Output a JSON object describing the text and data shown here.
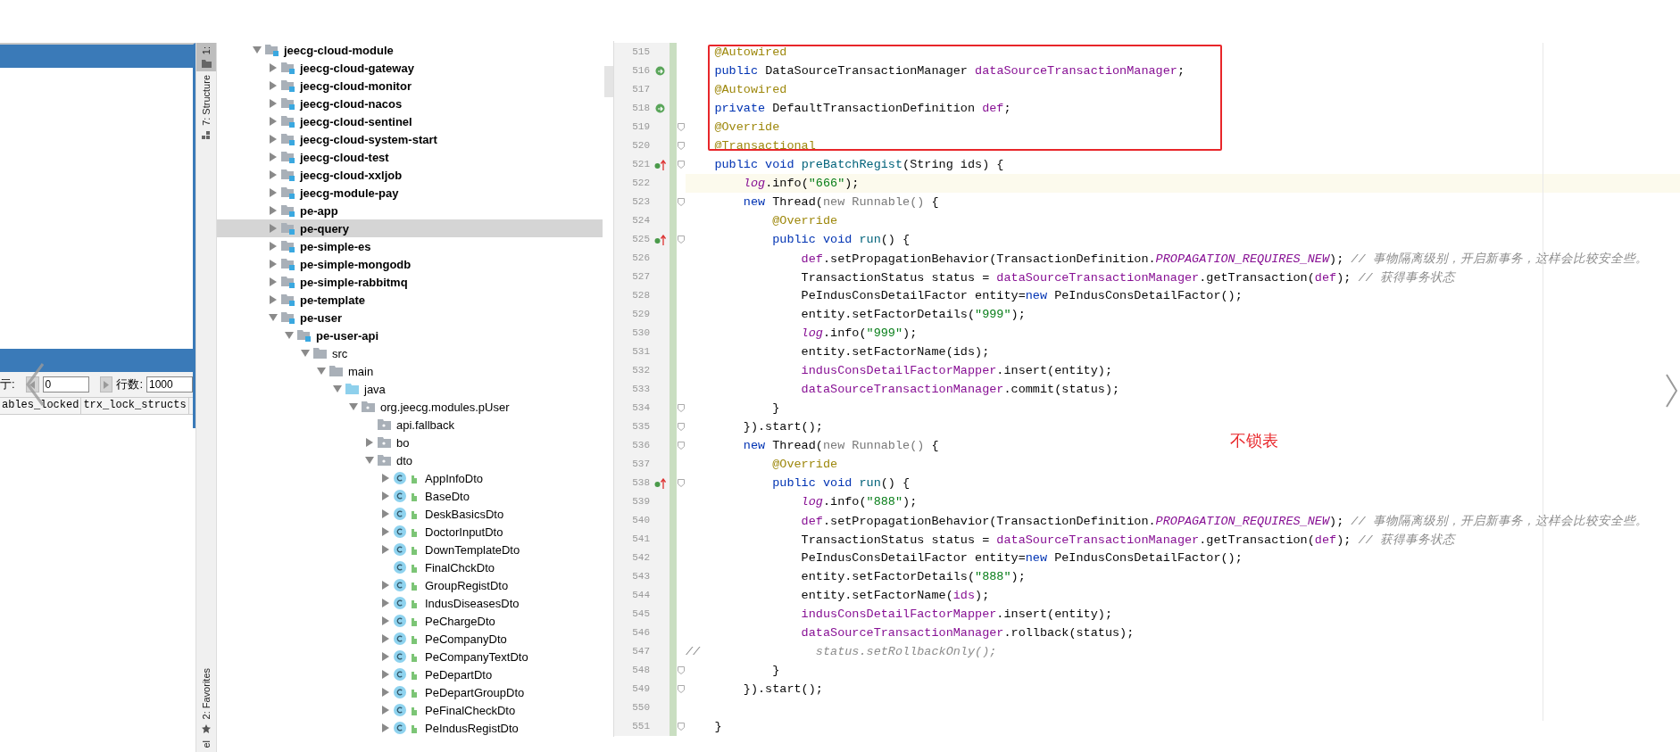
{
  "db_panel": {
    "pager": {
      "row_label": "亍:",
      "row_value": "0",
      "count_label": "行数:",
      "count_value": "1000"
    },
    "columns": [
      "ables_locked",
      "trx_lock_structs"
    ]
  },
  "side_tabs": [
    {
      "label": "1:",
      "kind": "folder",
      "selected": true
    },
    {
      "label": "7: Structure",
      "kind": "structure",
      "selected": false
    },
    {
      "label": "2: Favorites",
      "kind": "star",
      "selected": false
    },
    {
      "label": "el",
      "kind": "none",
      "selected": false
    }
  ],
  "project_tree": [
    {
      "label": "jeecg-cloud-module",
      "kind": "module",
      "expanded": true,
      "leaf": false,
      "selected": false,
      "children": [
        {
          "label": "jeecg-cloud-gateway",
          "kind": "module",
          "expanded": false,
          "leaf": false,
          "selected": false
        },
        {
          "label": "jeecg-cloud-monitor",
          "kind": "module",
          "expanded": false,
          "leaf": false,
          "selected": false
        },
        {
          "label": "jeecg-cloud-nacos",
          "kind": "module",
          "expanded": false,
          "leaf": false,
          "selected": false
        },
        {
          "label": "jeecg-cloud-sentinel",
          "kind": "module",
          "expanded": false,
          "leaf": false,
          "selected": false
        },
        {
          "label": "jeecg-cloud-system-start",
          "kind": "module",
          "expanded": false,
          "leaf": false,
          "selected": false
        },
        {
          "label": "jeecg-cloud-test",
          "kind": "module",
          "expanded": false,
          "leaf": false,
          "selected": false
        },
        {
          "label": "jeecg-cloud-xxljob",
          "kind": "module",
          "expanded": false,
          "leaf": false,
          "selected": false
        },
        {
          "label": "jeecg-module-pay",
          "kind": "module",
          "expanded": false,
          "leaf": false,
          "selected": false
        },
        {
          "label": "pe-app",
          "kind": "module",
          "expanded": false,
          "leaf": false,
          "selected": false
        },
        {
          "label": "pe-query",
          "kind": "module",
          "expanded": false,
          "leaf": false,
          "selected": true
        },
        {
          "label": "pe-simple-es",
          "kind": "module",
          "expanded": false,
          "leaf": false,
          "selected": false
        },
        {
          "label": "pe-simple-mongodb",
          "kind": "module",
          "expanded": false,
          "leaf": false,
          "selected": false
        },
        {
          "label": "pe-simple-rabbitmq",
          "kind": "module",
          "expanded": false,
          "leaf": false,
          "selected": false
        },
        {
          "label": "pe-template",
          "kind": "module",
          "expanded": false,
          "leaf": false,
          "selected": false
        },
        {
          "label": "pe-user",
          "kind": "module",
          "expanded": true,
          "leaf": false,
          "selected": false,
          "children": [
            {
              "label": "pe-user-api",
              "kind": "module",
              "expanded": true,
              "leaf": false,
              "selected": false,
              "children": [
                {
                  "label": "src",
                  "kind": "folder",
                  "expanded": true,
                  "leaf": false,
                  "selected": false,
                  "children": [
                    {
                      "label": "main",
                      "kind": "folder",
                      "expanded": true,
                      "leaf": false,
                      "selected": false,
                      "children": [
                        {
                          "label": "java",
                          "kind": "source",
                          "expanded": true,
                          "leaf": false,
                          "selected": false,
                          "children": [
                            {
                              "label": "org.jeecg.modules.pUser",
                              "kind": "package",
                              "expanded": true,
                              "leaf": false,
                              "selected": false,
                              "children": [
                                {
                                  "label": "api.fallback",
                                  "kind": "package",
                                  "leaf": true,
                                  "selected": false
                                },
                                {
                                  "label": "bo",
                                  "kind": "package",
                                  "expanded": false,
                                  "leaf": false,
                                  "selected": false
                                },
                                {
                                  "label": "dto",
                                  "kind": "package",
                                  "expanded": true,
                                  "leaf": false,
                                  "selected": false,
                                  "children": [
                                    {
                                      "label": "AppInfoDto",
                                      "kind": "class",
                                      "expanded": false,
                                      "leaf": false,
                                      "selected": false
                                    },
                                    {
                                      "label": "BaseDto",
                                      "kind": "class",
                                      "expanded": false,
                                      "leaf": false,
                                      "selected": false
                                    },
                                    {
                                      "label": "DeskBasicsDto",
                                      "kind": "class",
                                      "expanded": false,
                                      "leaf": false,
                                      "selected": false
                                    },
                                    {
                                      "label": "DoctorInputDto",
                                      "kind": "class",
                                      "expanded": false,
                                      "leaf": false,
                                      "selected": false
                                    },
                                    {
                                      "label": "DownTemplateDto",
                                      "kind": "class",
                                      "expanded": false,
                                      "leaf": false,
                                      "selected": false
                                    },
                                    {
                                      "label": "FinalChckDto",
                                      "kind": "class",
                                      "leaf": true,
                                      "selected": false
                                    },
                                    {
                                      "label": "GroupRegistDto",
                                      "kind": "class",
                                      "expanded": false,
                                      "leaf": false,
                                      "selected": false
                                    },
                                    {
                                      "label": "IndusDiseasesDto",
                                      "kind": "class",
                                      "expanded": false,
                                      "leaf": false,
                                      "selected": false
                                    },
                                    {
                                      "label": "PeChargeDto",
                                      "kind": "class",
                                      "expanded": false,
                                      "leaf": false,
                                      "selected": false
                                    },
                                    {
                                      "label": "PeCompanyDto",
                                      "kind": "class",
                                      "expanded": false,
                                      "leaf": false,
                                      "selected": false
                                    },
                                    {
                                      "label": "PeCompanyTextDto",
                                      "kind": "class",
                                      "expanded": false,
                                      "leaf": false,
                                      "selected": false
                                    },
                                    {
                                      "label": "PeDepartDto",
                                      "kind": "class",
                                      "expanded": false,
                                      "leaf": false,
                                      "selected": false
                                    },
                                    {
                                      "label": "PeDepartGroupDto",
                                      "kind": "class",
                                      "expanded": false,
                                      "leaf": false,
                                      "selected": false
                                    },
                                    {
                                      "label": "PeFinalCheckDto",
                                      "kind": "class",
                                      "expanded": false,
                                      "leaf": false,
                                      "selected": false
                                    },
                                    {
                                      "label": "PeIndusRegistDto",
                                      "kind": "class",
                                      "expanded": false,
                                      "leaf": false,
                                      "selected": false
                                    }
                                  ]
                                }
                              ]
                            }
                          ]
                        }
                      ]
                    }
                  ]
                }
              ]
            }
          ]
        }
      ]
    }
  ],
  "editor": {
    "note": "不锁表",
    "lines": [
      {
        "number": "515",
        "kind": "plain",
        "fold": false,
        "current": false,
        "segments": [
          {
            "kind": "ann",
            "text": "    @Autowired"
          }
        ]
      },
      {
        "number": "516",
        "kind": "bean",
        "fold": false,
        "current": false,
        "segments": [
          {
            "kind": "kw",
            "text": "    public "
          },
          {
            "kind": "plain",
            "text": "DataSourceTransactionManager "
          },
          {
            "kind": "field",
            "text": "dataSourceTransactionManager"
          },
          {
            "kind": "plain",
            "text": ";"
          }
        ]
      },
      {
        "number": "517",
        "kind": "plain",
        "fold": false,
        "current": false,
        "segments": [
          {
            "kind": "ann",
            "text": "    @Autowired"
          }
        ]
      },
      {
        "number": "518",
        "kind": "bean",
        "fold": false,
        "current": false,
        "segments": [
          {
            "kind": "kw",
            "text": "    private "
          },
          {
            "kind": "plain",
            "text": "DefaultTransactionDefinition "
          },
          {
            "kind": "field",
            "text": "def"
          },
          {
            "kind": "plain",
            "text": ";"
          }
        ]
      },
      {
        "number": "519",
        "kind": "plain",
        "fold": true,
        "current": false,
        "segments": [
          {
            "kind": "ann",
            "text": "    @Override"
          }
        ]
      },
      {
        "number": "520",
        "kind": "plain",
        "fold": true,
        "current": false,
        "segments": [
          {
            "kind": "ann",
            "text": "    @Transactional"
          }
        ]
      },
      {
        "number": "521",
        "kind": "override",
        "fold": true,
        "current": false,
        "segments": [
          {
            "kind": "kw",
            "text": "    public void "
          },
          {
            "kind": "decl",
            "text": "preBatchRegist"
          },
          {
            "kind": "plain",
            "text": "(String ids) {"
          }
        ]
      },
      {
        "number": "522",
        "kind": "plain",
        "fold": false,
        "current": true,
        "segments": [
          {
            "kind": "static",
            "text": "        log"
          },
          {
            "kind": "plain",
            "text": ".info("
          },
          {
            "kind": "str",
            "text": "\"666\""
          },
          {
            "kind": "plain",
            "text": ");"
          }
        ]
      },
      {
        "number": "523",
        "kind": "plain",
        "fold": true,
        "current": false,
        "segments": [
          {
            "kind": "kw",
            "text": "        new "
          },
          {
            "kind": "plain",
            "text": "Thread("
          },
          {
            "kind": "dim",
            "text": "new Runnable()"
          },
          {
            "kind": "plain",
            "text": " {"
          }
        ]
      },
      {
        "number": "524",
        "kind": "plain",
        "fold": false,
        "current": false,
        "segments": [
          {
            "kind": "ann",
            "text": "            @Override"
          }
        ]
      },
      {
        "number": "525",
        "kind": "override",
        "fold": true,
        "current": false,
        "segments": [
          {
            "kind": "kw",
            "text": "            public void "
          },
          {
            "kind": "decl",
            "text": "run"
          },
          {
            "kind": "plain",
            "text": "() {"
          }
        ]
      },
      {
        "number": "526",
        "kind": "plain",
        "fold": false,
        "current": false,
        "segments": [
          {
            "kind": "field",
            "text": "                def"
          },
          {
            "kind": "plain",
            "text": ".setPropagationBehavior(TransactionDefinition."
          },
          {
            "kind": "static",
            "text": "PROPAGATION_REQUIRES_NEW"
          },
          {
            "kind": "plain",
            "text": "); "
          },
          {
            "kind": "comment",
            "text": "// 事物隔离级别，开启新事务，这样会比较安全些。"
          }
        ]
      },
      {
        "number": "527",
        "kind": "plain",
        "fold": false,
        "current": false,
        "segments": [
          {
            "kind": "plain",
            "text": "                TransactionStatus status = "
          },
          {
            "kind": "field",
            "text": "dataSourceTransactionManager"
          },
          {
            "kind": "plain",
            "text": ".getTransaction("
          },
          {
            "kind": "field",
            "text": "def"
          },
          {
            "kind": "plain",
            "text": "); "
          },
          {
            "kind": "comment",
            "text": "// 获得事务状态"
          }
        ]
      },
      {
        "number": "528",
        "kind": "plain",
        "fold": false,
        "current": false,
        "segments": [
          {
            "kind": "plain",
            "text": "                PeIndusConsDetailFactor entity="
          },
          {
            "kind": "kw",
            "text": "new "
          },
          {
            "kind": "plain",
            "text": "PeIndusConsDetailFactor();"
          }
        ]
      },
      {
        "number": "529",
        "kind": "plain",
        "fold": false,
        "current": false,
        "segments": [
          {
            "kind": "plain",
            "text": "                entity.setFactorDetails("
          },
          {
            "kind": "str",
            "text": "\"999\""
          },
          {
            "kind": "plain",
            "text": ");"
          }
        ]
      },
      {
        "number": "530",
        "kind": "plain",
        "fold": false,
        "current": false,
        "segments": [
          {
            "kind": "static",
            "text": "                log"
          },
          {
            "kind": "plain",
            "text": ".info("
          },
          {
            "kind": "str",
            "text": "\"999\""
          },
          {
            "kind": "plain",
            "text": ");"
          }
        ]
      },
      {
        "number": "531",
        "kind": "plain",
        "fold": false,
        "current": false,
        "segments": [
          {
            "kind": "plain",
            "text": "                entity.setFactorName(ids);"
          }
        ]
      },
      {
        "number": "532",
        "kind": "plain",
        "fold": false,
        "current": false,
        "segments": [
          {
            "kind": "field",
            "text": "                indusConsDetailFactorMapper"
          },
          {
            "kind": "plain",
            "text": ".insert(entity);"
          }
        ]
      },
      {
        "number": "533",
        "kind": "plain",
        "fold": false,
        "current": false,
        "segments": [
          {
            "kind": "field",
            "text": "                dataSourceTransactionManager"
          },
          {
            "kind": "plain",
            "text": ".commit(status);"
          }
        ]
      },
      {
        "number": "534",
        "kind": "plain",
        "fold": true,
        "current": false,
        "segments": [
          {
            "kind": "plain",
            "text": "            }"
          }
        ]
      },
      {
        "number": "535",
        "kind": "plain",
        "fold": true,
        "current": false,
        "segments": [
          {
            "kind": "plain",
            "text": "        }).start();"
          }
        ]
      },
      {
        "number": "536",
        "kind": "plain",
        "fold": true,
        "current": false,
        "segments": [
          {
            "kind": "kw",
            "text": "        new "
          },
          {
            "kind": "plain",
            "text": "Thread("
          },
          {
            "kind": "dim",
            "text": "new Runnable()"
          },
          {
            "kind": "plain",
            "text": " {"
          }
        ]
      },
      {
        "number": "537",
        "kind": "plain",
        "fold": false,
        "current": false,
        "segments": [
          {
            "kind": "ann",
            "text": "            @Override"
          }
        ]
      },
      {
        "number": "538",
        "kind": "override",
        "fold": true,
        "current": false,
        "segments": [
          {
            "kind": "kw",
            "text": "            public void "
          },
          {
            "kind": "decl",
            "text": "run"
          },
          {
            "kind": "plain",
            "text": "() {"
          }
        ]
      },
      {
        "number": "539",
        "kind": "plain",
        "fold": false,
        "current": false,
        "segments": [
          {
            "kind": "static",
            "text": "                log"
          },
          {
            "kind": "plain",
            "text": ".info("
          },
          {
            "kind": "str",
            "text": "\"888\""
          },
          {
            "kind": "plain",
            "text": ");"
          }
        ]
      },
      {
        "number": "540",
        "kind": "plain",
        "fold": false,
        "current": false,
        "segments": [
          {
            "kind": "field",
            "text": "                def"
          },
          {
            "kind": "plain",
            "text": ".setPropagationBehavior(TransactionDefinition."
          },
          {
            "kind": "static",
            "text": "PROPAGATION_REQUIRES_NEW"
          },
          {
            "kind": "plain",
            "text": "); "
          },
          {
            "kind": "comment",
            "text": "// 事物隔离级别，开启新事务，这样会比较安全些。"
          }
        ]
      },
      {
        "number": "541",
        "kind": "plain",
        "fold": false,
        "current": false,
        "segments": [
          {
            "kind": "plain",
            "text": "                TransactionStatus status = "
          },
          {
            "kind": "field",
            "text": "dataSourceTransactionManager"
          },
          {
            "kind": "plain",
            "text": ".getTransaction("
          },
          {
            "kind": "field",
            "text": "def"
          },
          {
            "kind": "plain",
            "text": "); "
          },
          {
            "kind": "comment",
            "text": "// 获得事务状态"
          }
        ]
      },
      {
        "number": "542",
        "kind": "plain",
        "fold": false,
        "current": false,
        "segments": [
          {
            "kind": "plain",
            "text": "                PeIndusConsDetailFactor entity="
          },
          {
            "kind": "kw",
            "text": "new "
          },
          {
            "kind": "plain",
            "text": "PeIndusConsDetailFactor();"
          }
        ]
      },
      {
        "number": "543",
        "kind": "plain",
        "fold": false,
        "current": false,
        "segments": [
          {
            "kind": "plain",
            "text": "                entity.setFactorDetails("
          },
          {
            "kind": "str",
            "text": "\"888\""
          },
          {
            "kind": "plain",
            "text": ");"
          }
        ]
      },
      {
        "number": "544",
        "kind": "plain",
        "fold": false,
        "current": false,
        "segments": [
          {
            "kind": "plain",
            "text": "                entity.setFactorName("
          },
          {
            "kind": "field",
            "text": "ids"
          },
          {
            "kind": "plain",
            "text": ");"
          }
        ]
      },
      {
        "number": "545",
        "kind": "plain",
        "fold": false,
        "current": false,
        "segments": [
          {
            "kind": "field",
            "text": "                indusConsDetailFactorMapper"
          },
          {
            "kind": "plain",
            "text": ".insert(entity);"
          }
        ]
      },
      {
        "number": "546",
        "kind": "plain",
        "fold": false,
        "current": false,
        "segments": [
          {
            "kind": "field",
            "text": "                dataSourceTransactionManager"
          },
          {
            "kind": "plain",
            "text": ".rollback(status);"
          }
        ]
      },
      {
        "number": "547",
        "kind": "plain",
        "fold": false,
        "current": false,
        "segments": [
          {
            "kind": "comment",
            "text": "//                status.setRollbackOnly();"
          }
        ]
      },
      {
        "number": "548",
        "kind": "plain",
        "fold": true,
        "current": false,
        "segments": [
          {
            "kind": "plain",
            "text": "            }"
          }
        ]
      },
      {
        "number": "549",
        "kind": "plain",
        "fold": true,
        "current": false,
        "segments": [
          {
            "kind": "plain",
            "text": "        }).start();"
          }
        ]
      },
      {
        "number": "550",
        "kind": "plain",
        "fold": false,
        "current": false
      },
      {
        "number": "551",
        "kind": "plain",
        "fold": true,
        "current": false,
        "segments": [
          {
            "kind": "plain",
            "text": "    }"
          }
        ]
      }
    ]
  }
}
